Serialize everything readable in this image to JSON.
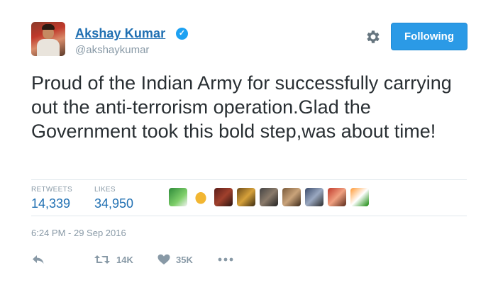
{
  "author": {
    "name": "Akshay Kumar",
    "handle": "@akshaykumar",
    "verified_icon": "verified-badge-icon"
  },
  "header": {
    "gear_icon": "gear-icon",
    "follow_label": "Following"
  },
  "tweet": {
    "text": "Proud of the Indian Army for successfully carrying out the anti-terrorism operation.Glad the Government took this bold step,was about time!"
  },
  "stats": {
    "retweets_label": "RETWEETS",
    "retweets_value": "14,339",
    "likes_label": "LIKES",
    "likes_value": "34,950"
  },
  "likers": [
    "liker-avatar-1",
    "liker-avatar-2",
    "liker-avatar-3",
    "liker-avatar-4",
    "liker-avatar-5",
    "liker-avatar-6",
    "liker-avatar-7",
    "liker-avatar-8",
    "liker-avatar-9"
  ],
  "timestamp": "6:24 PM - 29 Sep 2016",
  "actions": {
    "reply_icon": "reply-icon",
    "retweet_icon": "retweet-icon",
    "retweet_count": "14K",
    "like_icon": "heart-icon",
    "like_count": "35K",
    "more_icon": "more-dots-icon"
  },
  "colors": {
    "link_blue": "#1f6fb2",
    "button_blue": "#2b9ae6",
    "muted_gray": "#8899a6",
    "text_dark": "#292f33"
  }
}
